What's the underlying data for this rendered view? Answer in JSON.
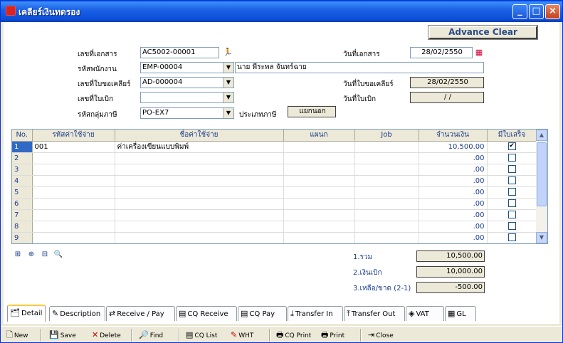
{
  "window": {
    "title": "เคลียร์เงินทดรอง"
  },
  "header": {
    "advance_clear": "Advance Clear"
  },
  "form": {
    "doc_no_label": "เลขที่เอกสาร",
    "doc_no": "AC5002-00001",
    "doc_date_label": "วันที่เอกสาร",
    "doc_date": "28/02/2550",
    "emp_label": "รหัสพนักงาน",
    "emp_code": "EMP-00004",
    "emp_name": "นาย พีระพล จันทร์ฉาย",
    "clear_req_label": "เลขที่ใบขอเคลียร์",
    "clear_req_no": "AD-000004",
    "clear_req_date_label": "วันที่ใบขอเคลียร์",
    "clear_req_date": "28/02/2550",
    "withdraw_label": "เลขที่ใบเบิก",
    "withdraw_no": "",
    "withdraw_date_label": "วันที่ใบเบิก",
    "withdraw_date": "/ /",
    "tax_group_label": "รหัสกลุ่มภาษี",
    "tax_group": "PO-EX7",
    "tax_type_label": "ประเภทภาษี",
    "tax_type": "แยกนอก"
  },
  "grid": {
    "columns": [
      "No.",
      "รหัสค่าใช้จ่าย",
      "ชื่อค่าใช้จ่าย",
      "แผนก",
      "Job",
      "จำนวนเงิน",
      "มีใบเสร็จ"
    ],
    "rows": [
      {
        "no": "1",
        "code": "001",
        "name": "ค่าเครื่องเขียนแบบพิมพ์",
        "dept": "",
        "job": "",
        "amount": "10,500.00",
        "receipt": "✔"
      },
      {
        "no": "2",
        "code": "",
        "name": "",
        "dept": "",
        "job": "",
        "amount": ".00",
        "receipt": ""
      },
      {
        "no": "3",
        "code": "",
        "name": "",
        "dept": "",
        "job": "",
        "amount": ".00",
        "receipt": ""
      },
      {
        "no": "4",
        "code": "",
        "name": "",
        "dept": "",
        "job": "",
        "amount": ".00",
        "receipt": ""
      },
      {
        "no": "5",
        "code": "",
        "name": "",
        "dept": "",
        "job": "",
        "amount": ".00",
        "receipt": ""
      },
      {
        "no": "6",
        "code": "",
        "name": "",
        "dept": "",
        "job": "",
        "amount": ".00",
        "receipt": ""
      },
      {
        "no": "7",
        "code": "",
        "name": "",
        "dept": "",
        "job": "",
        "amount": ".00",
        "receipt": ""
      },
      {
        "no": "8",
        "code": "",
        "name": "",
        "dept": "",
        "job": "",
        "amount": ".00",
        "receipt": ""
      },
      {
        "no": "9",
        "code": "",
        "name": "",
        "dept": "",
        "job": "",
        "amount": ".00",
        "receipt": ""
      }
    ]
  },
  "summary": {
    "total_label": "1.รวม",
    "total": "10,500.00",
    "withdrawn_label": "2.เงินเบิก",
    "withdrawn": "10,000.00",
    "balance_label": "3.เหลือ/ขาด (2-1)",
    "balance": "-500.00"
  },
  "tabs": [
    "Detail",
    "Description",
    "Receive / Pay",
    "CQ Receive",
    "CQ Pay",
    "Transfer In",
    "Transfer Out",
    "VAT",
    "GL"
  ],
  "toolbar": {
    "new": "New",
    "save": "Save",
    "delete": "Delete",
    "find": "Find",
    "cq_list": "CQ List",
    "wht": "WHT",
    "cq_print": "CQ Print",
    "print": "Print",
    "close": "Close"
  }
}
